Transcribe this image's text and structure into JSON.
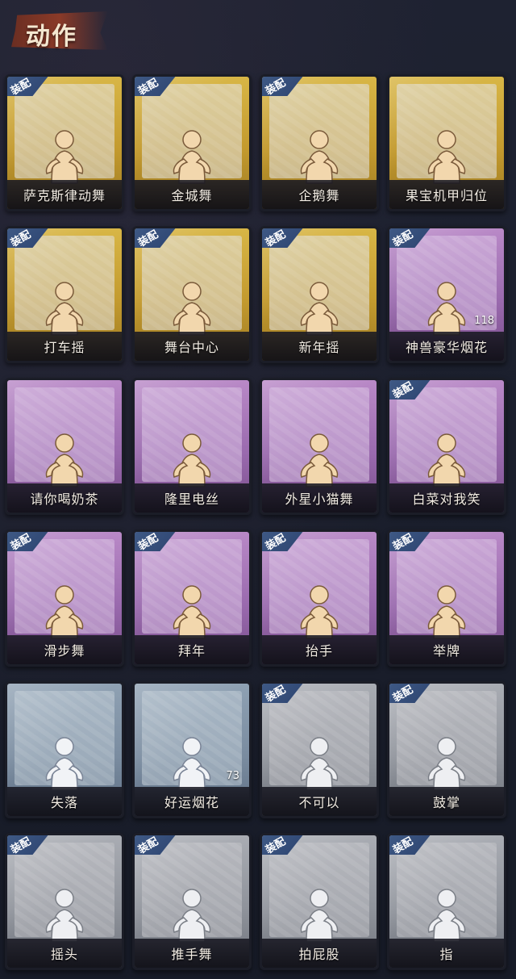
{
  "page": {
    "title": "动作"
  },
  "badge_text": "装配",
  "cards": [
    {
      "label": "萨克斯律动舞",
      "tier": "gold",
      "equipped": true,
      "count": "",
      "icon": "saxophone-dance-icon"
    },
    {
      "label": "金城舞",
      "tier": "gold",
      "equipped": true,
      "count": "",
      "icon": "golden-city-dance-icon"
    },
    {
      "label": "企鹅舞",
      "tier": "gold",
      "equipped": true,
      "count": "",
      "icon": "penguin-dance-icon"
    },
    {
      "label": "果宝机甲归位",
      "tier": "gold",
      "equipped": false,
      "count": "",
      "icon": "mecha-pose-icon"
    },
    {
      "label": "打车摇",
      "tier": "gold",
      "equipped": true,
      "count": "",
      "icon": "taxi-shake-icon"
    },
    {
      "label": "舞台中心",
      "tier": "gold",
      "equipped": true,
      "count": "",
      "icon": "stage-center-icon"
    },
    {
      "label": "新年摇",
      "tier": "gold",
      "equipped": true,
      "count": "",
      "icon": "new-year-shake-icon"
    },
    {
      "label": "神兽豪华烟花",
      "tier": "purple",
      "equipped": true,
      "count": "118",
      "icon": "fireworks-icon"
    },
    {
      "label": "请你喝奶茶",
      "tier": "purple",
      "equipped": false,
      "count": "",
      "icon": "milk-tea-icon"
    },
    {
      "label": "隆里电丝",
      "tier": "purple",
      "equipped": false,
      "count": "",
      "icon": "pointing-dance-icon"
    },
    {
      "label": "外星小猫舞",
      "tier": "purple",
      "equipped": false,
      "count": "",
      "icon": "alien-cat-dance-icon"
    },
    {
      "label": "白菜对我笑",
      "tier": "purple",
      "equipped": true,
      "count": "",
      "icon": "cabbage-smile-icon"
    },
    {
      "label": "滑步舞",
      "tier": "purple",
      "equipped": true,
      "count": "",
      "icon": "slide-dance-icon"
    },
    {
      "label": "拜年",
      "tier": "purple",
      "equipped": true,
      "count": "",
      "icon": "new-year-greeting-icon"
    },
    {
      "label": "抬手",
      "tier": "purple",
      "equipped": true,
      "count": "",
      "icon": "raise-hand-icon"
    },
    {
      "label": "举牌",
      "tier": "purple",
      "equipped": true,
      "count": "",
      "icon": "hold-sign-icon"
    },
    {
      "label": "失落",
      "tier": "blue",
      "equipped": false,
      "count": "",
      "icon": "crawl-sad-icon"
    },
    {
      "label": "好运烟花",
      "tier": "blue",
      "equipped": false,
      "count": "73",
      "icon": "lucky-firework-icon"
    },
    {
      "label": "不可以",
      "tier": "gray",
      "equipped": true,
      "count": "",
      "icon": "finger-wag-icon"
    },
    {
      "label": "鼓掌",
      "tier": "gray",
      "equipped": true,
      "count": "",
      "icon": "clap-icon"
    },
    {
      "label": "摇头",
      "tier": "gray",
      "equipped": true,
      "count": "",
      "icon": "head-shake-icon"
    },
    {
      "label": "推手舞",
      "tier": "gray",
      "equipped": true,
      "count": "",
      "icon": "push-dance-icon"
    },
    {
      "label": "拍屁股",
      "tier": "gray",
      "equipped": true,
      "count": "",
      "icon": "butt-pat-icon"
    },
    {
      "label": "指",
      "tier": "gray",
      "equipped": true,
      "count": "",
      "icon": "point-icon"
    }
  ],
  "colors": {
    "gold": "#c39a2e",
    "purple": "#9a6aae",
    "blue": "#7a8ca0",
    "gray": "#8f939b",
    "badge": "#3f5a86",
    "title_banner": "#8a3a28"
  }
}
